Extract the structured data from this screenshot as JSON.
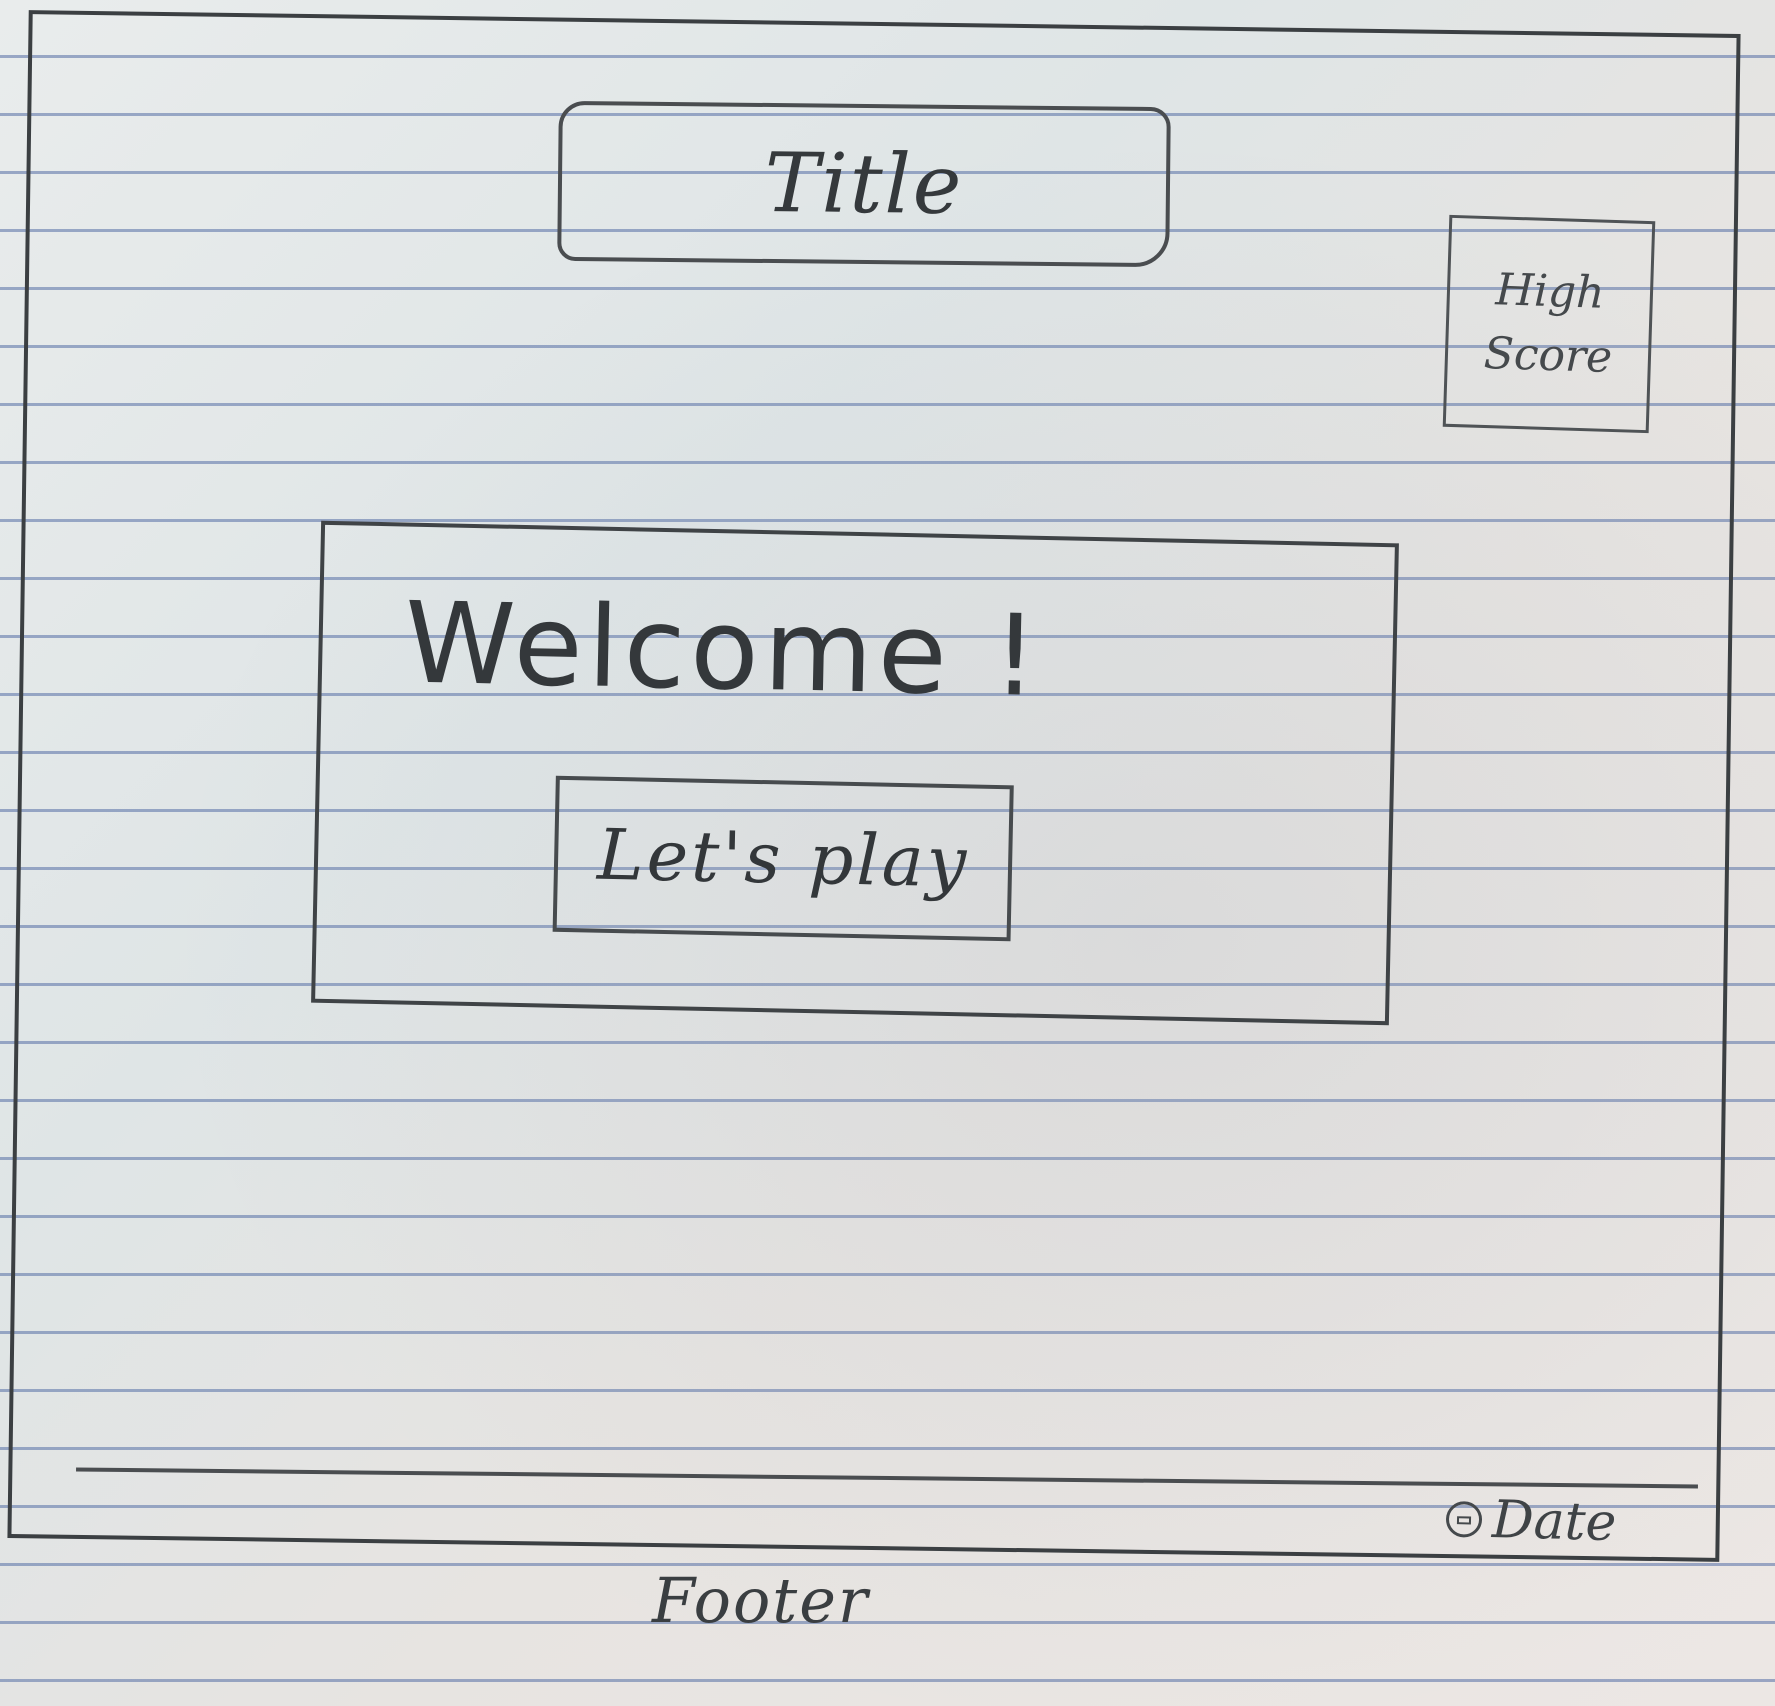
{
  "header": {
    "title": "Title",
    "high_score_label": "High Score"
  },
  "main": {
    "welcome_text": "Welcome !",
    "play_button_label": "Let's play"
  },
  "footer": {
    "date_label": "Date",
    "date_icon": "copyright-icon",
    "label": "Footer"
  },
  "colors": {
    "ink": "#3b3f42",
    "paper": "#e9ecec",
    "rule_line": "#556ea5"
  }
}
